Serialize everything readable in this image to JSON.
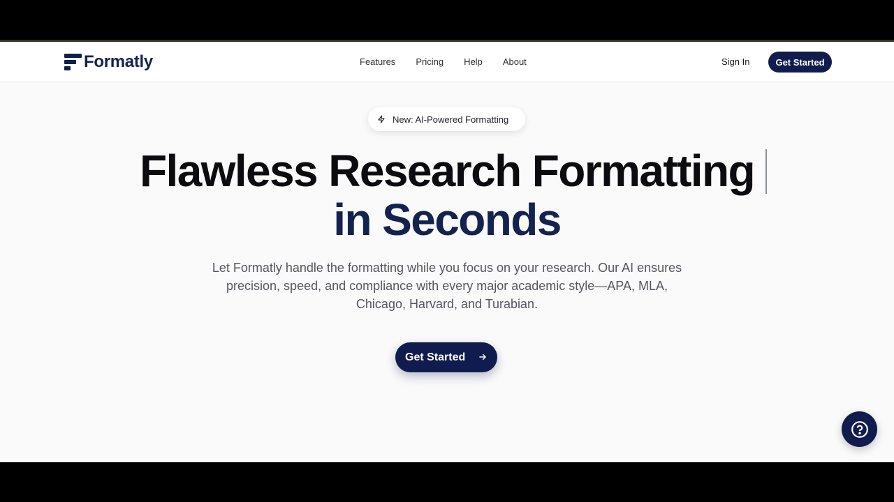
{
  "brand": {
    "name": "Formatly",
    "color": "#13234f",
    "accent": "#0f1c4d"
  },
  "nav": {
    "items": [
      {
        "label": "Features"
      },
      {
        "label": "Pricing"
      },
      {
        "label": "Help"
      },
      {
        "label": "About"
      }
    ],
    "sign_in": "Sign In",
    "get_started": "Get Started"
  },
  "hero": {
    "badge": {
      "icon": "zap-icon",
      "text": "New: AI-Powered Formatting"
    },
    "title_line1": "Flawless Research Formatting",
    "title_line2": "in Seconds",
    "subtitle": "Let Formatly handle the formatting while you focus on your research. Our AI ensures precision, speed, and compliance with every major academic style—APA, MLA, Chicago, Harvard, and Turabian.",
    "cta": {
      "label": "Get Started",
      "icon": "arrow-right-icon"
    }
  },
  "help_button": {
    "icon": "help-circle-icon"
  }
}
